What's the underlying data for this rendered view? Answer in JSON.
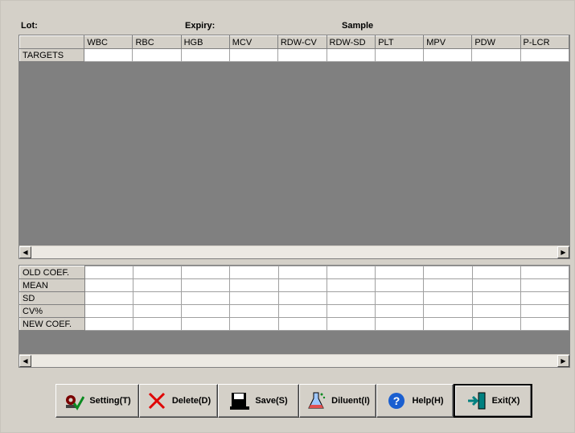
{
  "header": {
    "lot_label": "Lot:",
    "expiry_label": "Expiry:",
    "sample_label": "Sample"
  },
  "top_grid": {
    "columns": [
      "WBC",
      "RBC",
      "HGB",
      "MCV",
      "RDW-CV",
      "RDW-SD",
      "PLT",
      "MPV",
      "PDW",
      "P-LCR"
    ],
    "rows": [
      "TARGETS"
    ]
  },
  "bottom_grid": {
    "rows": [
      "OLD COEF.",
      "MEAN",
      "SD",
      "CV%",
      "NEW COEF."
    ]
  },
  "buttons": [
    {
      "label": "Setting(T)",
      "icon": "setting-icon"
    },
    {
      "label": "Delete(D)",
      "icon": "delete-icon"
    },
    {
      "label": "Save(S)",
      "icon": "save-icon"
    },
    {
      "label": "Diluent(I)",
      "icon": "diluent-icon"
    },
    {
      "label": "Help(H)",
      "icon": "help-icon"
    },
    {
      "label": "Exit(X)",
      "icon": "exit-icon"
    }
  ],
  "colors": {
    "window_bg": "#d4d0c8",
    "grid_empty_bg": "#808080",
    "delete_icon": "#e00000",
    "help_icon": "#1a5fd0",
    "exit_icon": "#008080"
  }
}
